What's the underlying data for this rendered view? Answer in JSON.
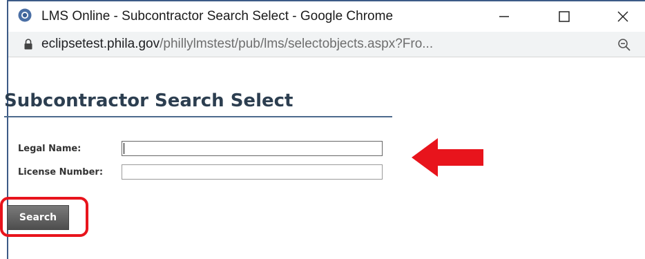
{
  "window": {
    "title": "LMS Online - Subcontractor Search Select - Google Chrome",
    "controls": {
      "minimize": "—",
      "maximize": "☐",
      "close": "✕"
    }
  },
  "address_bar": {
    "host": "eclipsetest.phila.gov",
    "path": "/phillylmstest/pub/lms/selectobjects.aspx?Fro..."
  },
  "page": {
    "title": "Subcontractor Search Select",
    "form": {
      "legal_name_label": "Legal Name:",
      "legal_name_value": "",
      "license_number_label": "License Number:",
      "license_number_value": ""
    },
    "search_button": "Search"
  },
  "annotations": {
    "highlight_color": "#e8141c",
    "arrow_color": "#e8141c"
  },
  "icons": [
    "chrome-icon",
    "lock-icon",
    "zoom-icon",
    "arrow-left-icon"
  ]
}
